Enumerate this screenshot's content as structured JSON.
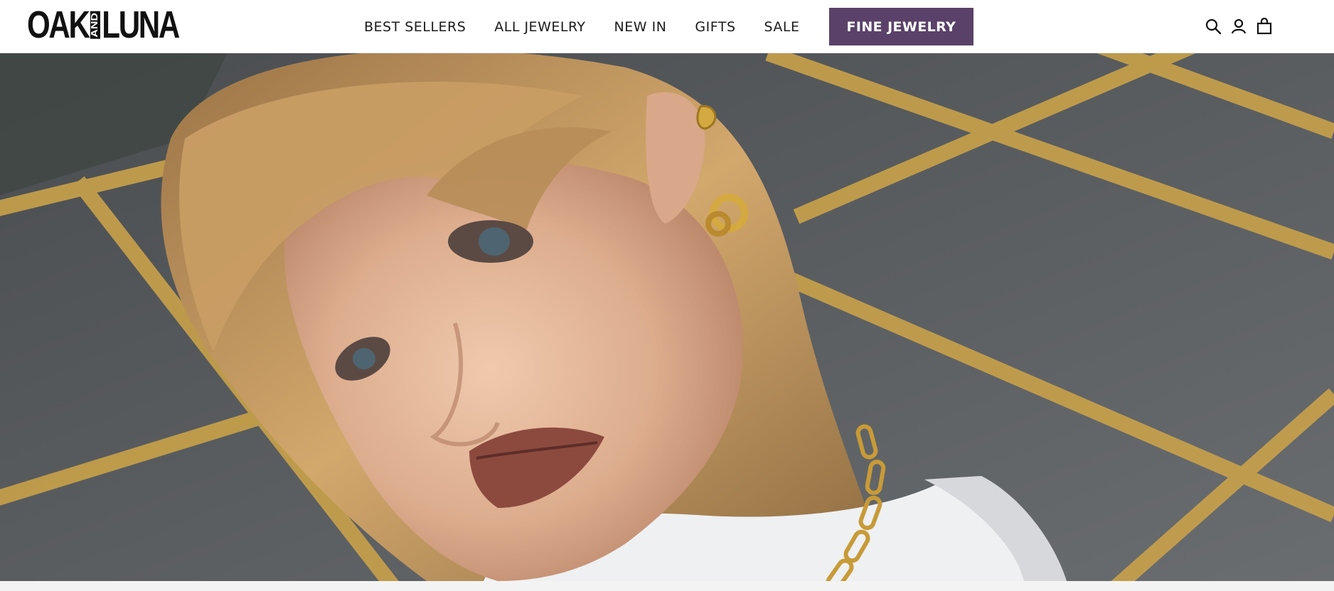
{
  "brand": {
    "logo_left": "OAK",
    "logo_mid": "AND",
    "logo_right": "LUNA"
  },
  "nav": {
    "items": [
      {
        "label": "BEST SELLERS"
      },
      {
        "label": "ALL JEWELRY"
      },
      {
        "label": "NEW IN"
      },
      {
        "label": "GIFTS"
      },
      {
        "label": "SALE"
      }
    ],
    "featured": {
      "label": "FINE JEWELRY",
      "background": "#5a4169"
    }
  },
  "header_icons": [
    "search-icon",
    "account-icon",
    "cart-icon"
  ],
  "hero": {
    "image_subject": "close-up portrait model wearing gold earrings and paperclip chain necklace on asphalt with yellow lines",
    "colors": {
      "asphalt": "#5c5f62",
      "lines": "#c9a24a",
      "hair": "#c79b63",
      "skin": "#e1b598"
    }
  }
}
